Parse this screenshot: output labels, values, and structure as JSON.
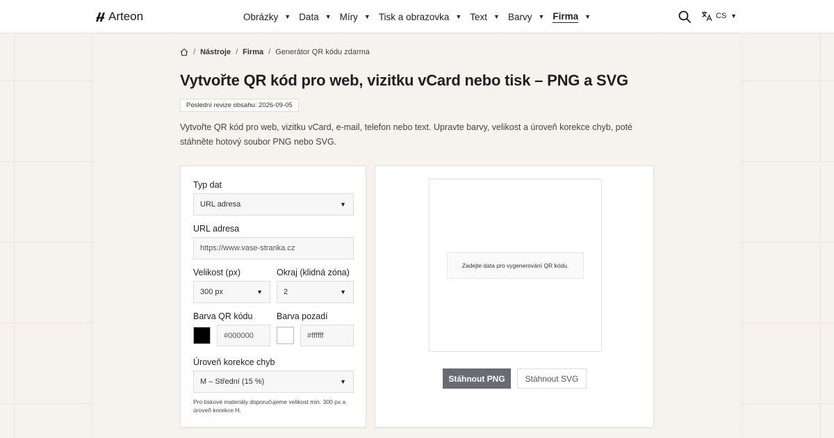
{
  "header": {
    "logo_text": "Arteon",
    "nav": [
      {
        "label": "Obrázky",
        "active": false
      },
      {
        "label": "Data",
        "active": false
      },
      {
        "label": "Míry",
        "active": false
      },
      {
        "label": "Tisk a obrazovka",
        "active": false
      },
      {
        "label": "Text",
        "active": false
      },
      {
        "label": "Barvy",
        "active": false
      },
      {
        "label": "Firma",
        "active": true
      }
    ],
    "language": "CS"
  },
  "breadcrumb": {
    "items": [
      "Nástroje",
      "Firma",
      "Generátor QR kódu zdarma"
    ]
  },
  "page": {
    "title": "Vytvořte QR kód pro web, vizitku vCard nebo tisk – PNG a SVG",
    "revision": "Poslední revize obsahu: 2026-09-05",
    "intro": "Vytvořte QR kód pro web, vizitku vCard, e-mail, telefon nebo text. Upravte barvy, velikost a úroveň korekce chyb, poté stáhněte hotový soubor PNG nebo SVG."
  },
  "form": {
    "data_type_label": "Typ dat",
    "data_type_value": "URL adresa",
    "url_label": "URL adresa",
    "url_value": "https://www.vase-stranka.cz",
    "size_label": "Velikost (px)",
    "size_value": "300 px",
    "margin_label": "Okraj (klidná zóna)",
    "margin_value": "2",
    "qr_color_label": "Barva QR kódu",
    "qr_color_value": "#000000",
    "bg_color_label": "Barva pozadí",
    "bg_color_value": "#ffffff",
    "ecc_label": "Úroveň korekce chyb",
    "ecc_value": "M – Střední (15 %)",
    "hint": "Pro tiskové materiály doporučujeme velikost min. 300 px a úroveň korekce H."
  },
  "preview": {
    "placeholder": "Zadejte data pro vygenerování QR kódu.",
    "download_png": "Stáhnout PNG",
    "download_svg": "Stáhnout SVG"
  },
  "colors": {
    "primary_button": "#6a6a72",
    "qr_swatch": "#000000",
    "bg_swatch": "#ffffff"
  }
}
